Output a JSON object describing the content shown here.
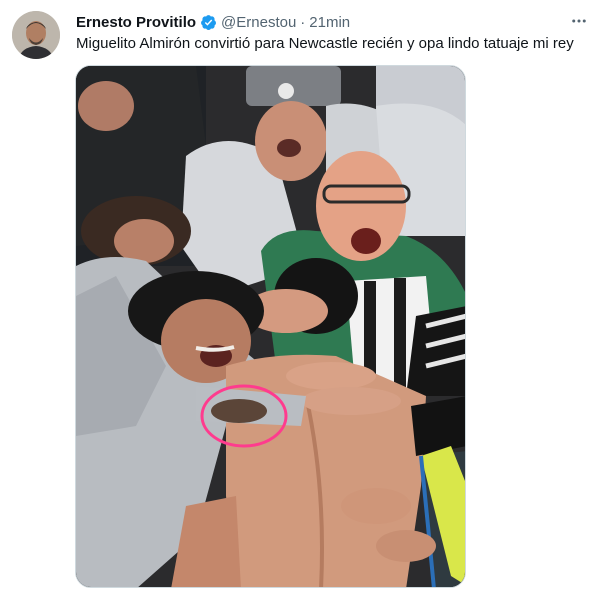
{
  "tweet": {
    "author_name": "Ernesto Provitilo",
    "handle": "@Ernestou",
    "separator": "·",
    "time": "21min",
    "text": "Miguelito Almirón convirtió para Newcastle recién y opa lindo tatuaje mi rey",
    "verified_icon": "verified-badge-icon",
    "more_icon": "more-options-icon"
  },
  "colors": {
    "verified": "#1d9bf0",
    "annotation_circle": "#ff3b8e",
    "secondary_text": "#536471"
  }
}
